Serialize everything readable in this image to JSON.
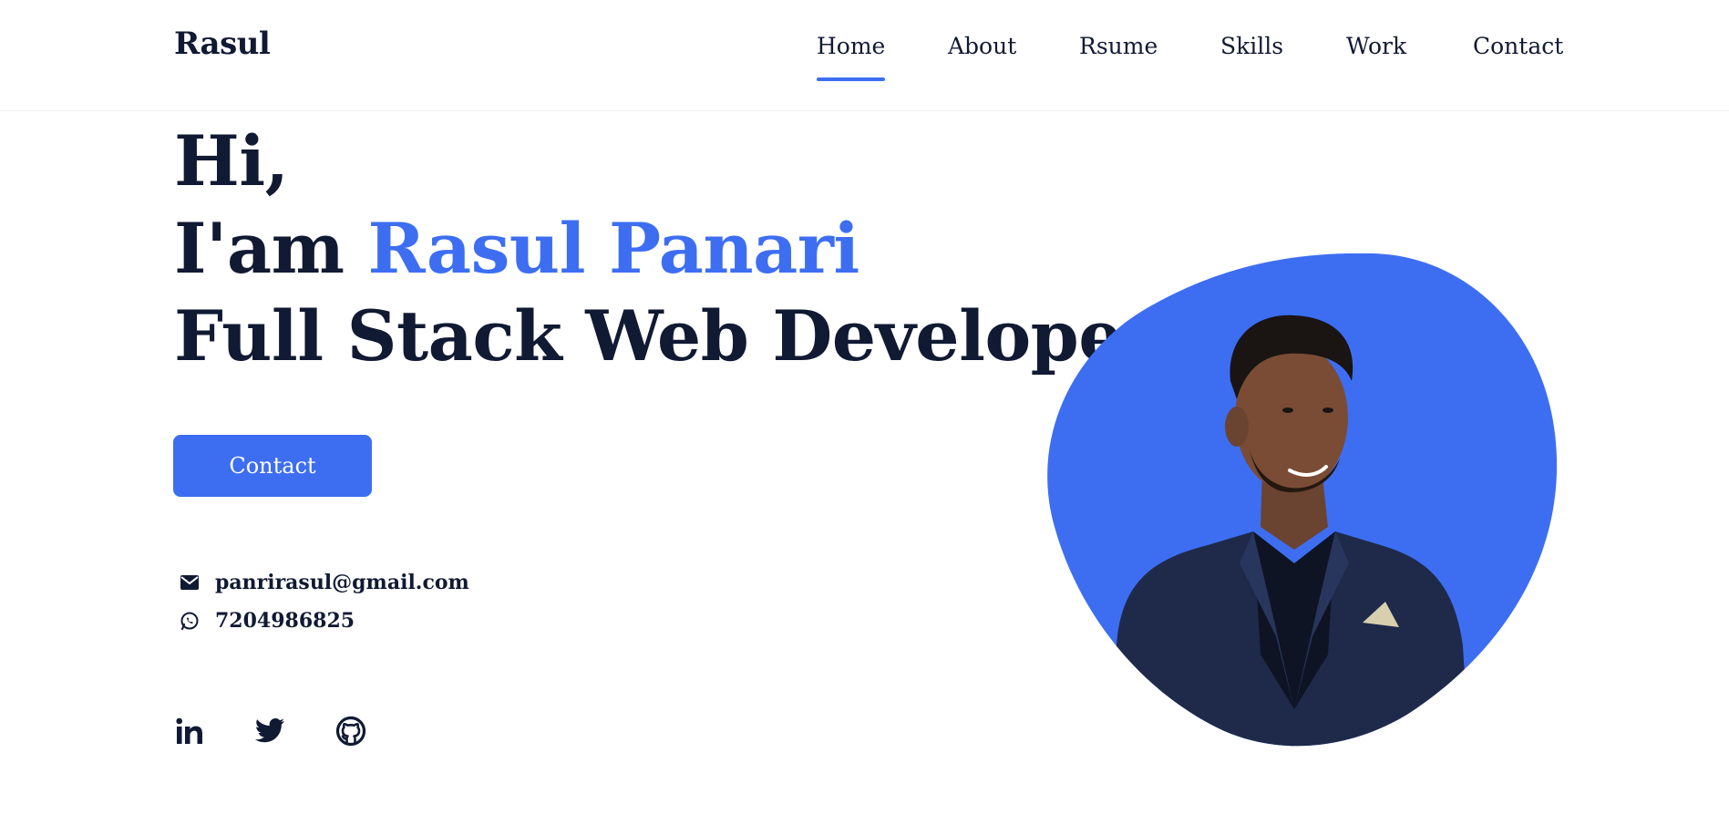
{
  "header": {
    "logo": "Rasul",
    "nav": [
      {
        "label": "Home",
        "active": true
      },
      {
        "label": "About",
        "active": false
      },
      {
        "label": "Rsume",
        "active": false
      },
      {
        "label": "Skills",
        "active": false
      },
      {
        "label": "Work",
        "active": false
      },
      {
        "label": "Contact",
        "active": false
      }
    ]
  },
  "hero": {
    "greeting": "Hi,",
    "intro_prefix": "I'am",
    "name": "Rasul Panari",
    "role": "Full Stack Web Developer",
    "cta_label": "Contact"
  },
  "contact": {
    "email": "panrirasul@gmail.com",
    "phone": "7204986825",
    "email_icon": "mail-icon",
    "phone_icon": "whatsapp-icon"
  },
  "social": [
    {
      "icon": "linkedin-icon"
    },
    {
      "icon": "twitter-icon"
    },
    {
      "icon": "github-icon"
    }
  ],
  "colors": {
    "accent": "#3d6ef2",
    "text": "#111a33",
    "background": "#ffffff"
  }
}
